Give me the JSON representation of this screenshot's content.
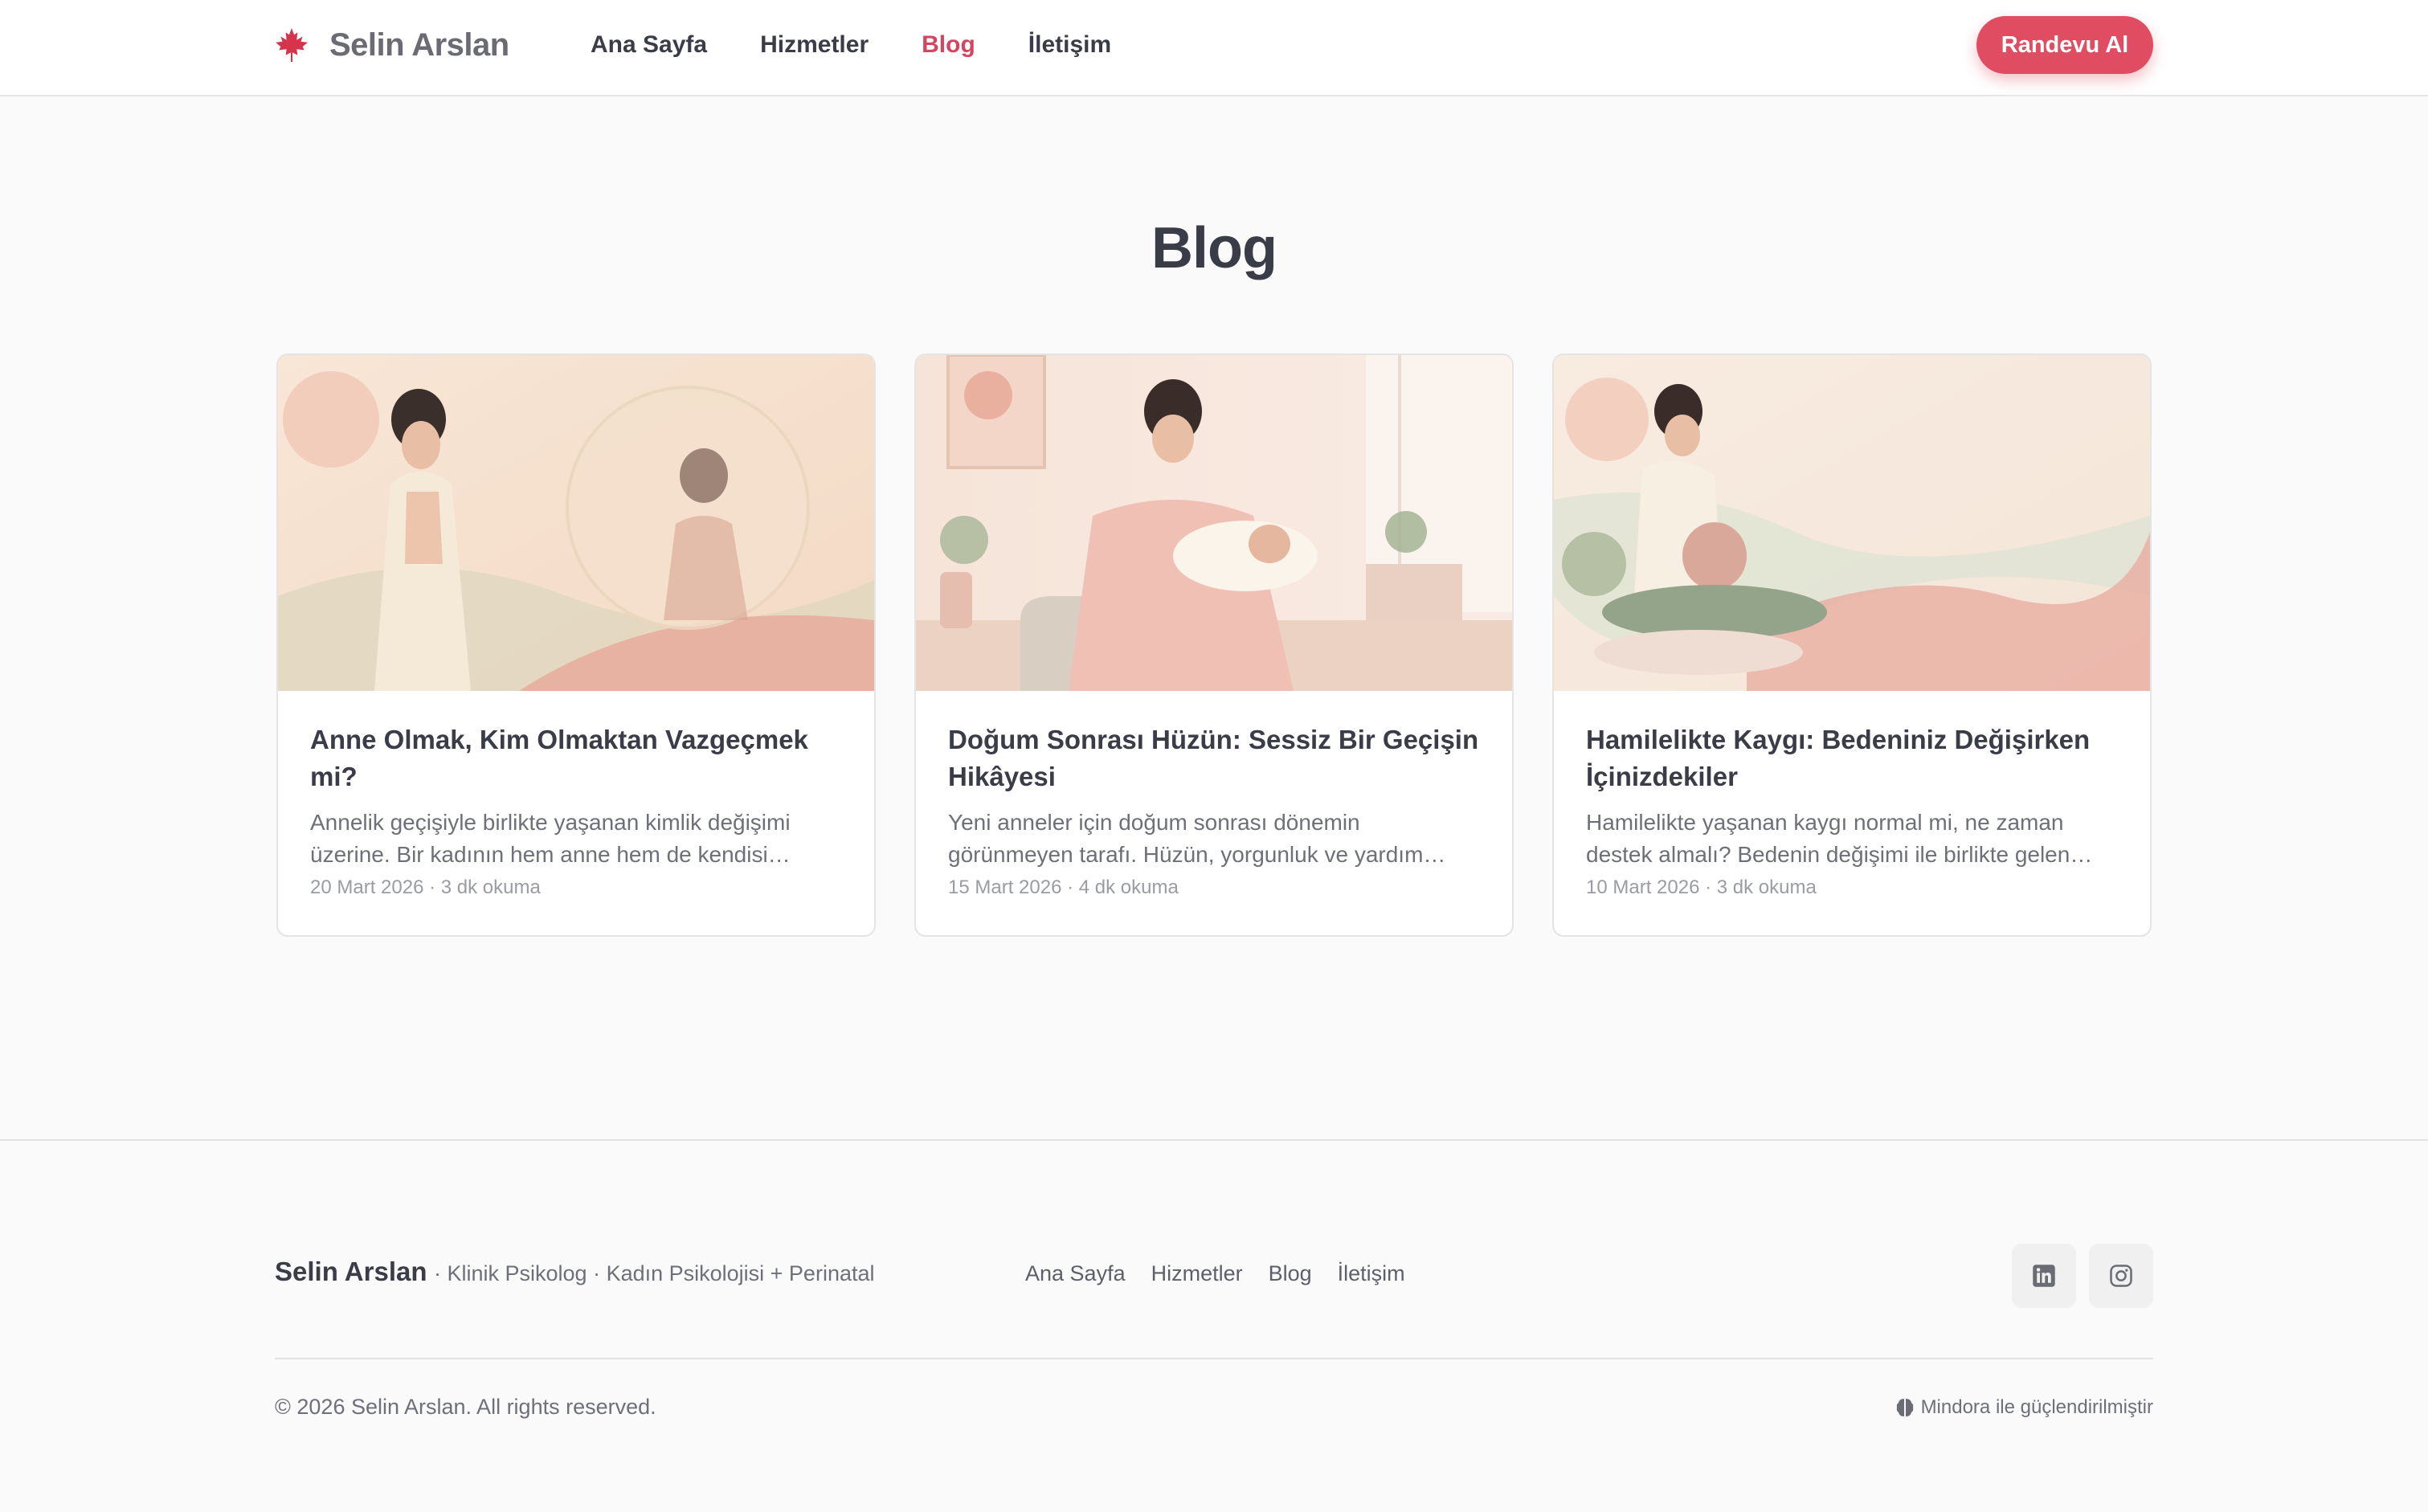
{
  "header": {
    "brand": "Selin Arslan",
    "logo_icon": "maple-leaf-icon",
    "nav": [
      {
        "label": "Ana Sayfa",
        "active": false
      },
      {
        "label": "Hizmetler",
        "active": false
      },
      {
        "label": "Blog",
        "active": true
      },
      {
        "label": "İletişim",
        "active": false
      }
    ],
    "cta_label": "Randevu Al"
  },
  "page": {
    "title": "Blog"
  },
  "posts": [
    {
      "title": "Anne Olmak, Kim Olmaktan Vazgeçmek mi?",
      "excerpt": "Annelik geçişiyle birlikte yaşanan kimlik değişimi üzerine. Bir kadının hem anne hem de kendisi…",
      "meta": "20 Mart 2026 · 3 dk okuma"
    },
    {
      "title": "Doğum Sonrası Hüzün: Sessiz Bir Geçişin Hikâyesi",
      "excerpt": "Yeni anneler için doğum sonrası dönemin görünmeyen tarafı. Hüzün, yorgunluk ve yardım…",
      "meta": "15 Mart 2026 · 4 dk okuma"
    },
    {
      "title": "Hamilelikte Kaygı: Bedeniniz Değişirken İçinizdekiler",
      "excerpt": "Hamilelikte yaşanan kaygı normal mi, ne zaman destek almalı? Bedenin değişimi ile birlikte gelen…",
      "meta": "10 Mart 2026 · 3 dk okuma"
    }
  ],
  "footer": {
    "brand": "Selin Arslan",
    "tagline": "· Klinik Psikolog · Kadın Psikolojisi + Perinatal",
    "nav": [
      "Ana Sayfa",
      "Hizmetler",
      "Blog",
      "İletişim"
    ],
    "social": [
      "linkedin-icon",
      "instagram-icon"
    ],
    "copyright": "© 2026 Selin Arslan. All rights reserved.",
    "powered": "Mindora ile güçlendirilmiştir"
  },
  "colors": {
    "accent": "#e04d62",
    "active_nav": "#d64560",
    "text": "#3a3d48",
    "muted": "#6e7079",
    "background": "#fafafa"
  }
}
